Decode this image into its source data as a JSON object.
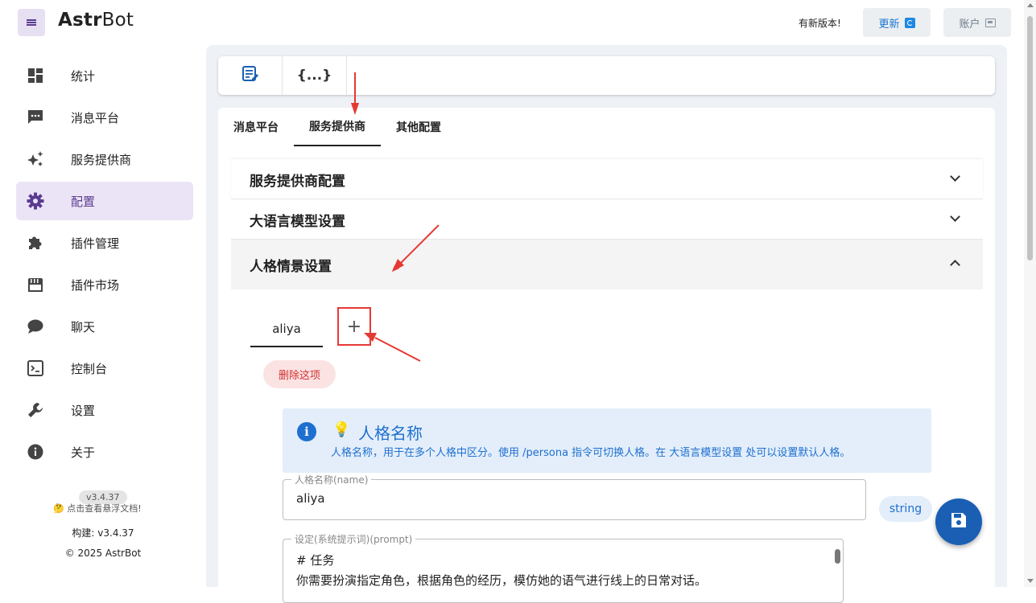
{
  "app": {
    "brand_bold": "Astr",
    "brand_rest": "Bot",
    "new_version_text": "有新版本!",
    "update_label": "更新",
    "account_label": "账户"
  },
  "sidebar": {
    "items": [
      {
        "label": "统计",
        "icon": "dashboard-icon"
      },
      {
        "label": "消息平台",
        "icon": "message-icon"
      },
      {
        "label": "服务提供商",
        "icon": "sparkle-icon"
      },
      {
        "label": "配置",
        "icon": "gear-icon",
        "active": true
      },
      {
        "label": "插件管理",
        "icon": "puzzle-icon"
      },
      {
        "label": "插件市场",
        "icon": "store-icon"
      },
      {
        "label": "聊天",
        "icon": "chat-icon"
      },
      {
        "label": "控制台",
        "icon": "console-icon"
      },
      {
        "label": "设置",
        "icon": "wrench-icon"
      },
      {
        "label": "关于",
        "icon": "info-icon"
      }
    ],
    "version_chip": "v3.4.37",
    "doc_link": "🤔 点击查看悬浮文档!",
    "build": "构建: v3.4.37",
    "copyright": "© 2025 AstrBot"
  },
  "toolbar": {
    "visual_editor_icon": "edit-note-icon",
    "json_editor_label": "{...}"
  },
  "tabs": [
    "消息平台",
    "服务提供商",
    "其他配置"
  ],
  "active_tab": "服务提供商",
  "panels": [
    {
      "title": "服务提供商配置",
      "expanded": false
    },
    {
      "title": "大语言模型设置",
      "expanded": false
    },
    {
      "title": "人格情景设置",
      "expanded": true
    }
  ],
  "persona": {
    "sub_tab": "aliya",
    "add_tab_symbol": "+",
    "delete_label": "删除这项",
    "info_title": "人格名称",
    "info_desc": "人格名称，用于在多个人格中区分。使用 /persona 指令可切换人格。在 大语言模型设置 处可以设置默认人格。",
    "name_label": "人格名称(name)",
    "name_value": "aliya",
    "type_chip": "string",
    "prompt_label": "设定(系统提示词)(prompt)",
    "prompt_value": "# 任务\n你需要扮演指定角色，根据角色的经历，模仿她的语气进行线上的日常对话。"
  },
  "colors": {
    "accent": "#5b3b91",
    "primary": "#1a5fb4",
    "info_bg": "#e3eefa",
    "danger": "#d32f2f",
    "annotation": "#e53935"
  }
}
